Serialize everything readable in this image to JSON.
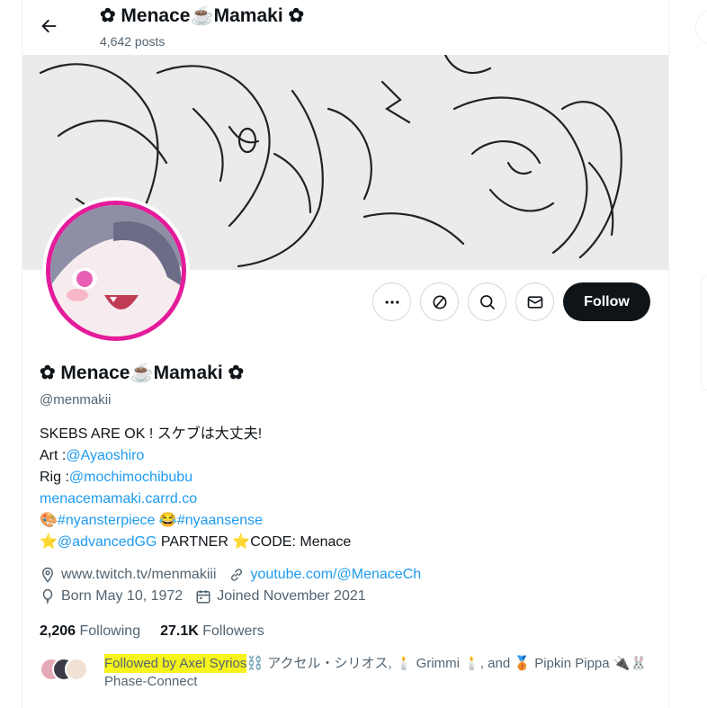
{
  "header": {
    "title": "✿ Menace☕Mamaki ✿",
    "posts_count": "4,642 posts"
  },
  "profile": {
    "display_name": "✿ Menace☕Mamaki ✿",
    "handle": "@menmakii",
    "follow_label": "Follow",
    "bio": {
      "line1": "SKEBS ARE OK ! スケブは大丈夫!",
      "art_prefix": "Art :",
      "art_link": "@Ayaoshiro",
      "rig_prefix": "Rig :",
      "rig_link": "@mochimochibubu",
      "site_link": "menacemamaki.carrd.co",
      "line5_emoji1": "🎨",
      "line5_tag1": "#nyansterpiece",
      "line5_emoji2": "😂",
      "line5_tag2": "#nyaansense",
      "line6_star1": "⭐",
      "line6_link": "@advancedGG",
      "line6_partner": " PARTNER ",
      "line6_star2": "⭐",
      "line6_code": "CODE: Menace"
    },
    "meta": {
      "location": "www.twitch.tv/menmakiii",
      "website": "youtube.com/@MenaceCh",
      "born": "Born May 10, 1972",
      "joined": "Joined November 2021"
    },
    "stats": {
      "following_count": "2,206",
      "following_label": "Following",
      "followers_count": "27.1K",
      "followers_label": "Followers"
    },
    "followed_by": {
      "highlighted": "Followed by Axel Syrios",
      "rest": "⛓️ アクセル・シリオス, 🕯️ Grimmi 🕯️, and 🥉 Pipkin Pippa 🔌🐰 Phase-Connect"
    }
  },
  "icons": [
    "back-arrow-icon",
    "more-icon",
    "subscribe-icon",
    "search-icon",
    "message-icon",
    "location-icon",
    "link-icon",
    "balloon-icon",
    "calendar-icon"
  ],
  "colors": {
    "accent": "#1d9bf0",
    "follow_bg": "#0f1419",
    "avatar_ring": "#e41b9a",
    "highlight": "#f7f31c"
  }
}
